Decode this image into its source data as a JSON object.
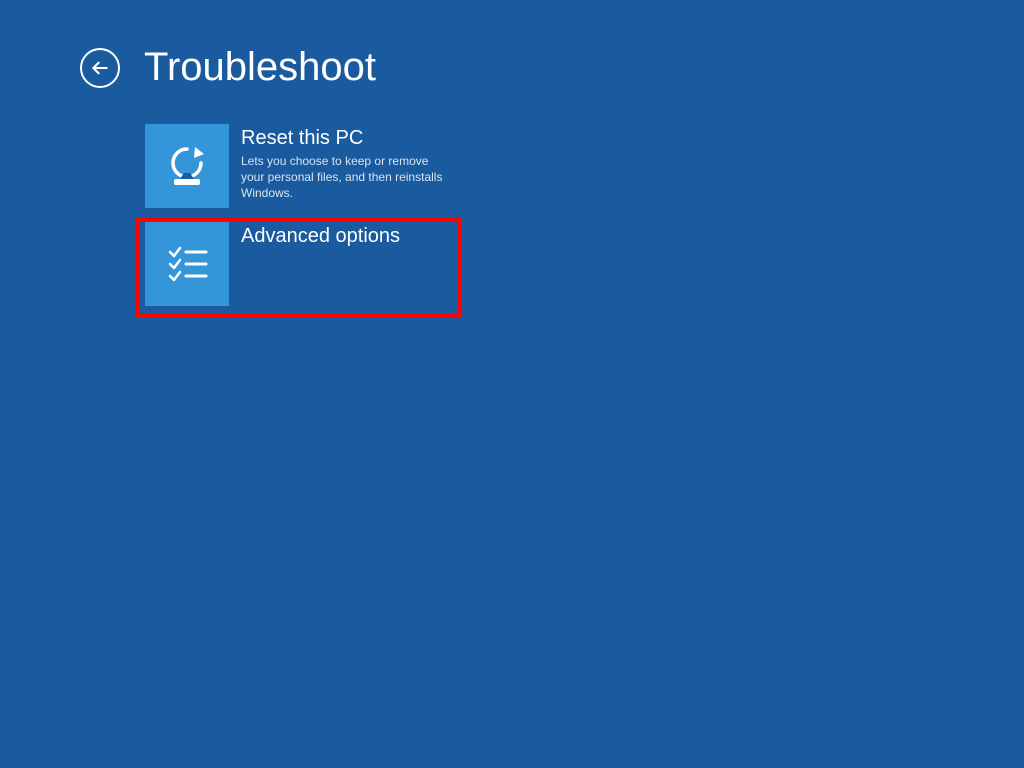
{
  "header": {
    "title": "Troubleshoot"
  },
  "options": {
    "reset": {
      "title": "Reset this PC",
      "description": "Lets you choose to keep or remove your personal files, and then reinstalls Windows."
    },
    "advanced": {
      "title": "Advanced options"
    }
  },
  "colors": {
    "background": "#1a5a9e",
    "tile": "#3496d8",
    "highlight": "#ff0000"
  }
}
